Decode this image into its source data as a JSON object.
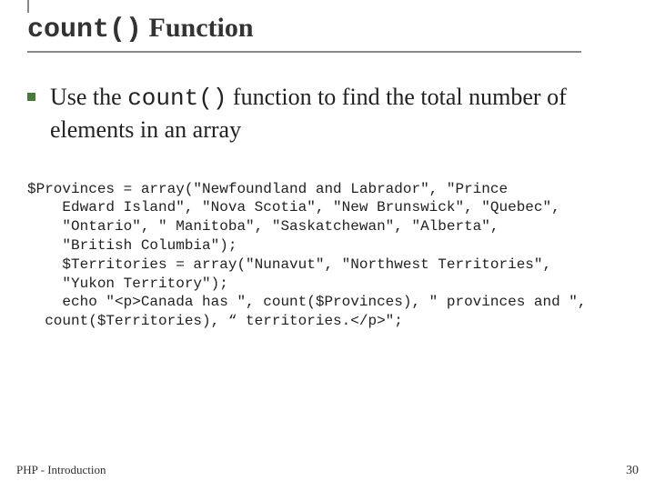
{
  "title": {
    "code": "count()",
    "rest": " Function"
  },
  "bullet": {
    "prefix": "Use the ",
    "code": "count()",
    "suffix": " function to find the total number of elements in an array"
  },
  "code": "$Provinces = array(\"Newfoundland and Labrador\", \"Prince \n    Edward Island\", \"Nova Scotia\", \"New Brunswick\", \"Quebec\", \n    \"Ontario\", \" Manitoba\", \"Saskatchewan\", \"Alberta\", \n    \"British Columbia\");\n    $Territories = array(\"Nunavut\", \"Northwest Territories\", \n    \"Yukon Territory\");\n    echo \"<p>Canada has \", count($Provinces), \" provinces and \",\n  count($Territories), “ territories.</p>\";",
  "footer": {
    "left": "PHP - Introduction",
    "right": "30"
  }
}
